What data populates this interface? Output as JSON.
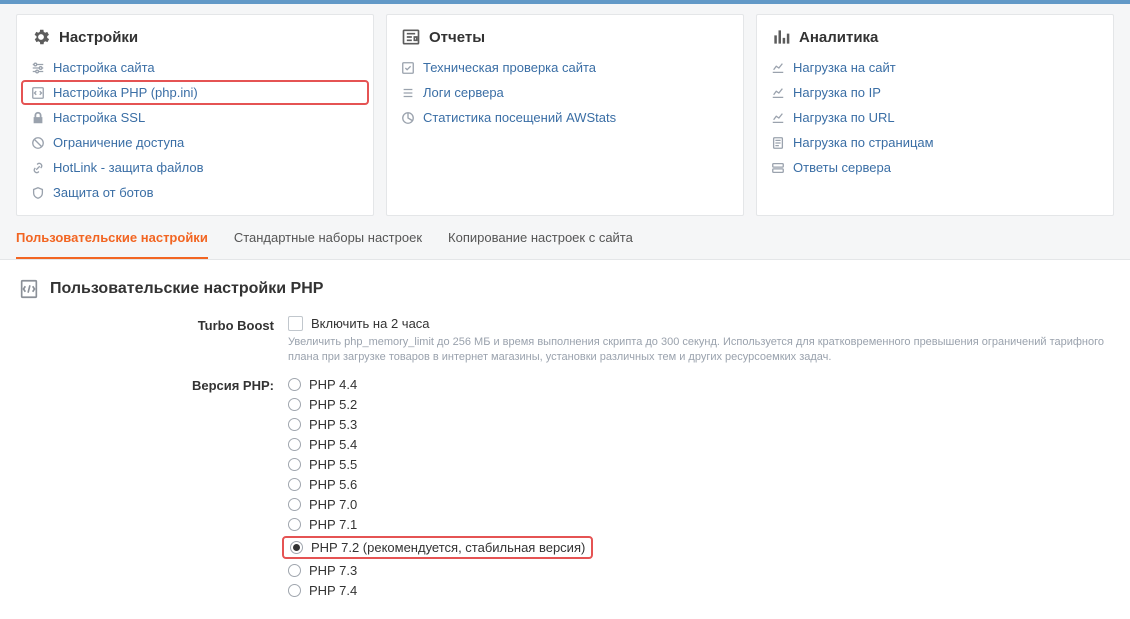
{
  "cards": [
    {
      "title": "Настройки",
      "items": [
        {
          "label": "Настройка сайта",
          "highlighted": false
        },
        {
          "label": "Настройка PHP (php.ini)",
          "highlighted": true
        },
        {
          "label": "Настройка SSL",
          "highlighted": false
        },
        {
          "label": "Ограничение доступа",
          "highlighted": false
        },
        {
          "label": "HotLink - защита файлов",
          "highlighted": false
        },
        {
          "label": "Защита от ботов",
          "highlighted": false
        }
      ]
    },
    {
      "title": "Отчеты",
      "items": [
        {
          "label": "Техническая проверка сайта"
        },
        {
          "label": "Логи сервера"
        },
        {
          "label": "Статистика посещений AWStats"
        }
      ]
    },
    {
      "title": "Аналитика",
      "items": [
        {
          "label": "Нагрузка на сайт"
        },
        {
          "label": "Нагрузка по IP"
        },
        {
          "label": "Нагрузка по URL"
        },
        {
          "label": "Нагрузка по страницам"
        },
        {
          "label": "Ответы сервера"
        }
      ]
    }
  ],
  "tabs": [
    {
      "label": "Пользовательские настройки",
      "active": true
    },
    {
      "label": "Стандартные наборы настроек",
      "active": false
    },
    {
      "label": "Копирование настроек с сайта",
      "active": false
    }
  ],
  "section": {
    "title": "Пользовательские настройки PHP"
  },
  "turbo": {
    "label": "Turbo Boost",
    "checkbox_label": "Включить на 2 часа",
    "help": "Увеличить php_memory_limit до 256 МБ и время выполнения скрипта до 300 секунд. Используется для кратковременного превышения ограничений тарифного плана при загрузке товаров в интернет магазины, установки различных тем и других ресурсоемких задач."
  },
  "php_version": {
    "label": "Версия PHP:",
    "options": [
      {
        "label": "PHP 4.4",
        "checked": false,
        "highlighted": false
      },
      {
        "label": "PHP 5.2",
        "checked": false,
        "highlighted": false
      },
      {
        "label": "PHP 5.3",
        "checked": false,
        "highlighted": false
      },
      {
        "label": "PHP 5.4",
        "checked": false,
        "highlighted": false
      },
      {
        "label": "PHP 5.5",
        "checked": false,
        "highlighted": false
      },
      {
        "label": "PHP 5.6",
        "checked": false,
        "highlighted": false
      },
      {
        "label": "PHP 7.0",
        "checked": false,
        "highlighted": false
      },
      {
        "label": "PHP 7.1",
        "checked": false,
        "highlighted": false
      },
      {
        "label": "PHP 7.2 (рекомендуется, стабильная версия)",
        "checked": true,
        "highlighted": true
      },
      {
        "label": "PHP 7.3",
        "checked": false,
        "highlighted": false
      },
      {
        "label": "PHP 7.4",
        "checked": false,
        "highlighted": false
      }
    ]
  }
}
